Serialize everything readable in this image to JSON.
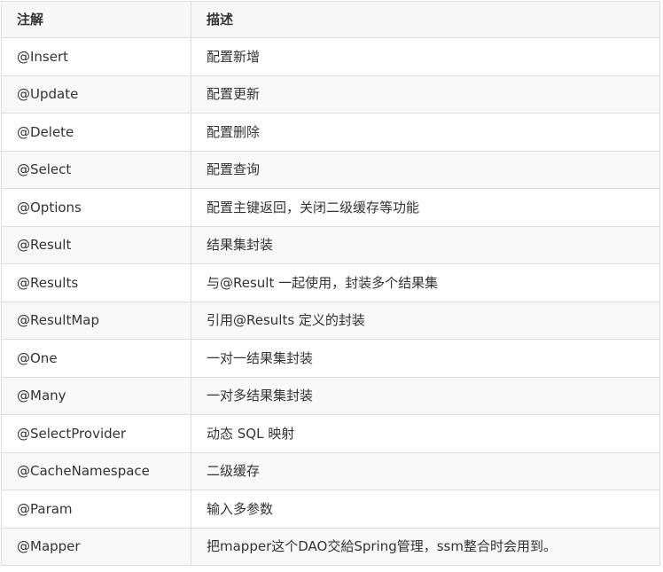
{
  "table": {
    "headers": [
      "注解",
      "描述"
    ],
    "rows": [
      [
        "@Insert",
        "配置新增"
      ],
      [
        "@Update",
        "配置更新"
      ],
      [
        "@Delete",
        "配置删除"
      ],
      [
        "@Select",
        "配置查询"
      ],
      [
        "@Options",
        "配置主键返回，关闭二级缓存等功能"
      ],
      [
        "@Result",
        "结果集封装"
      ],
      [
        "@Results",
        "与@Result 一起使用，封装多个结果集"
      ],
      [
        "@ResultMap",
        "引用@Results 定义的封装"
      ],
      [
        "@One",
        "一对一结果集封装"
      ],
      [
        "@Many",
        "一对多结果集封装"
      ],
      [
        "@SelectProvider",
        "动态 SQL 映射"
      ],
      [
        "@CacheNamespace",
        "二级缓存"
      ],
      [
        "@Param",
        "输入多参数"
      ],
      [
        "@Mapper",
        "把mapper这个DAO交給Spring管理，ssm整合时会用到。"
      ]
    ]
  },
  "colors": {
    "border": "#dddddd",
    "header_bg": "#f7f7f7",
    "stripe_bg": "#f8f8f8",
    "text": "#333333"
  }
}
